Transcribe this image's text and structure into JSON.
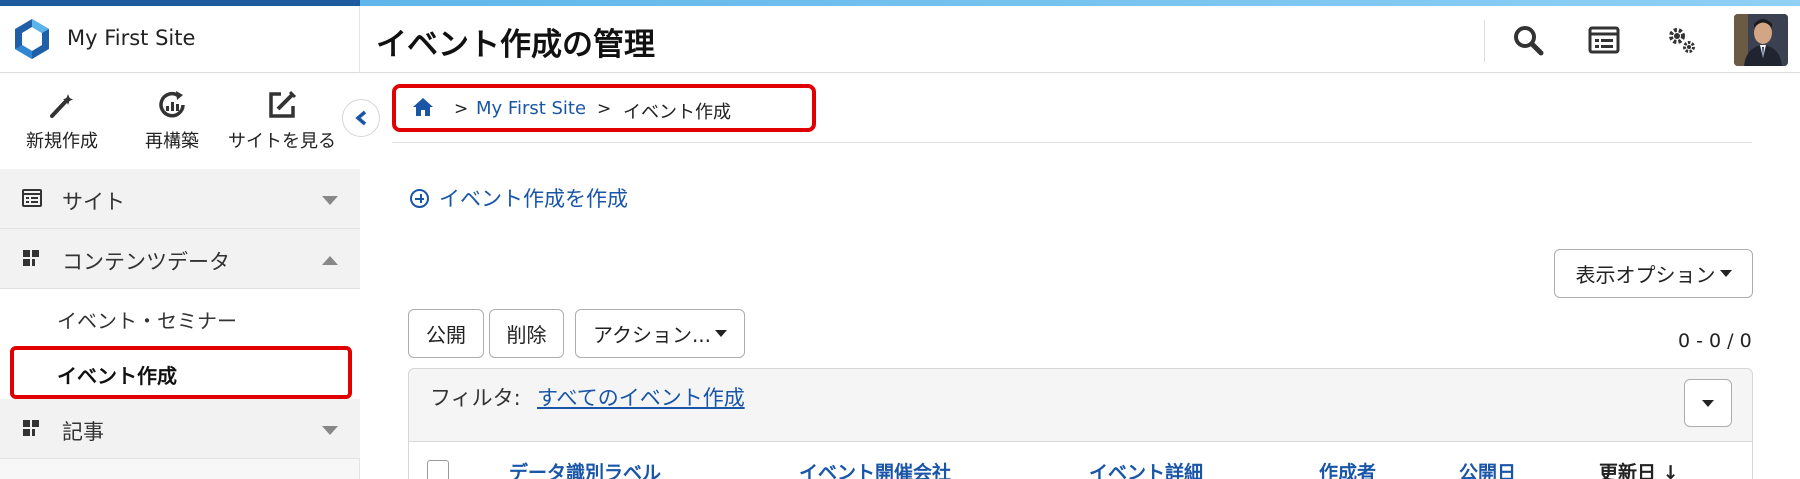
{
  "header": {
    "site_name": "My First Site",
    "page_title": "イベント作成の管理",
    "icons": [
      "search-icon",
      "site-list-icon",
      "settings-icon",
      "user-avatar"
    ]
  },
  "quick_actions": [
    {
      "label": "新規作成",
      "icon": "pencil-icon"
    },
    {
      "label": "再構築",
      "icon": "rebuild-icon"
    },
    {
      "label": "サイトを見る",
      "icon": "view-site-icon"
    }
  ],
  "sidebar": {
    "sections": [
      {
        "label": "サイト",
        "icon": "site-icon",
        "expanded": false
      },
      {
        "label": "コンテンツデータ",
        "icon": "content-data-icon",
        "expanded": true
      },
      {
        "label": "記事",
        "icon": "article-icon",
        "expanded": false
      }
    ],
    "content_items": [
      {
        "label": "イベント・セミナー",
        "active": false
      },
      {
        "label": "イベント作成",
        "active": true
      }
    ]
  },
  "breadcrumb": {
    "home_icon": "home-icon",
    "separator": ">",
    "site_link": "My First Site",
    "current": "イベント作成"
  },
  "main": {
    "create_link": "イベント作成を作成",
    "display_options": "表示オプション",
    "actions": {
      "publish": "公開",
      "delete": "削除",
      "more": "アクション..."
    },
    "count": "0 - 0 / 0",
    "filter_label": "フィルタ:",
    "filter_value": "すべてのイベント作成",
    "columns": [
      "データ識別ラベル",
      "イベント開催会社",
      "イベント詳細",
      "作成者",
      "公開日",
      "更新日 ↓"
    ]
  },
  "colors": {
    "accent": "#1a56a8",
    "highlight": "#e00000",
    "stripe_dark": "#1e5a9e",
    "stripe_light": "#8fd0f4"
  }
}
